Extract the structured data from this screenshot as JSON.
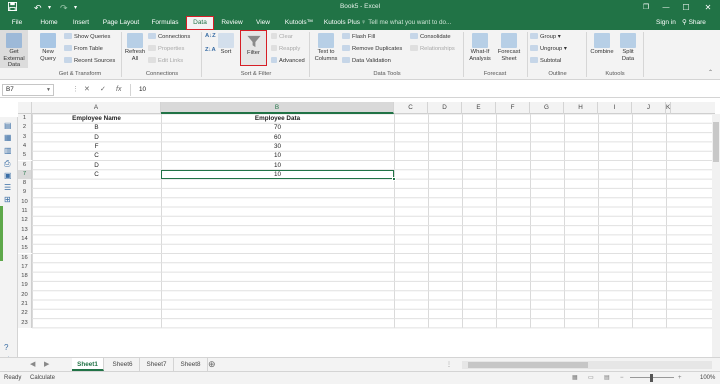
{
  "title": "Book5 - Excel",
  "window_controls": {
    "restore": "❐",
    "minimize": "—",
    "maximize": "☐",
    "close": "✕"
  },
  "quick_access": {
    "save_icon": "floppy-icon",
    "undo_icon": "undo-icon",
    "redo_icon": "redo-icon",
    "customize_icon": "dropdown-icon"
  },
  "tabs": [
    {
      "label": "File"
    },
    {
      "label": "Home"
    },
    {
      "label": "Insert"
    },
    {
      "label": "Page Layout"
    },
    {
      "label": "Formulas"
    },
    {
      "label": "Data"
    },
    {
      "label": "Review"
    },
    {
      "label": "View"
    },
    {
      "label": "Kutools™"
    },
    {
      "label": "Kutools Plus"
    }
  ],
  "active_tab": "Data",
  "tell_me": "Tell me what you want to do...",
  "sign_in": "Sign in",
  "share": "Share",
  "ribbon": {
    "get_external_data": "Get External Data",
    "new_query": "New Query",
    "show_queries": "Show Queries",
    "from_table": "From Table",
    "recent_sources": "Recent Sources",
    "refresh_all": "Refresh All",
    "connections": "Connections",
    "properties": "Properties",
    "edit_links": "Edit Links",
    "sort_az": "A↓Z",
    "sort_za": "Z↓A",
    "sort": "Sort",
    "filter": "Filter",
    "clear": "Clear",
    "reapply": "Reapply",
    "advanced": "Advanced",
    "text_to_columns": "Text to Columns",
    "flash_fill": "Flash Fill",
    "remove_duplicates": "Remove Duplicates",
    "data_validation": "Data Validation",
    "consolidate": "Consolidate",
    "relationships": "Relationships",
    "what_if": "What-If Analysis",
    "forecast_sheet": "Forecast Sheet",
    "group": "Group",
    "ungroup": "Ungroup",
    "subtotal": "Subtotal",
    "combine": "Combine",
    "split_data": "Split Data",
    "groups": {
      "get_transform": "Get & Transform",
      "connections": "Connections",
      "sort_filter": "Sort & Filter",
      "data_tools": "Data Tools",
      "forecast": "Forecast",
      "outline": "Outline",
      "kutools": "Kutools"
    }
  },
  "formula_bar": {
    "name_box": "B7",
    "cancel": "✕",
    "enter": "✓",
    "fx": "fx",
    "value": "10"
  },
  "columns": [
    "A",
    "B",
    "C",
    "D",
    "E",
    "F",
    "G",
    "H",
    "I",
    "J",
    "K"
  ],
  "rows": [
    "1",
    "2",
    "3",
    "4",
    "5",
    "6",
    "7",
    "8",
    "9",
    "10",
    "11",
    "12",
    "13",
    "14",
    "15",
    "16",
    "17",
    "18",
    "19",
    "20",
    "21",
    "22",
    "23"
  ],
  "table": {
    "headers": [
      "Employee Name",
      "Employee Data"
    ],
    "rows": [
      [
        "B",
        "70"
      ],
      [
        "D",
        "60"
      ],
      [
        "F",
        "30"
      ],
      [
        "C",
        "10"
      ],
      [
        "D",
        "10"
      ],
      [
        "C",
        "10"
      ]
    ]
  },
  "sheets": [
    "Sheet1",
    "Sheet6",
    "Sheet7",
    "Sheet8"
  ],
  "active_sheet": "Sheet1",
  "add_sheet": "⊕",
  "status": {
    "ready": "Ready",
    "calculate": "Calculate",
    "zoom": "100%"
  },
  "colors": {
    "excel_green": "#217346",
    "highlight_red": "#d61f26"
  }
}
